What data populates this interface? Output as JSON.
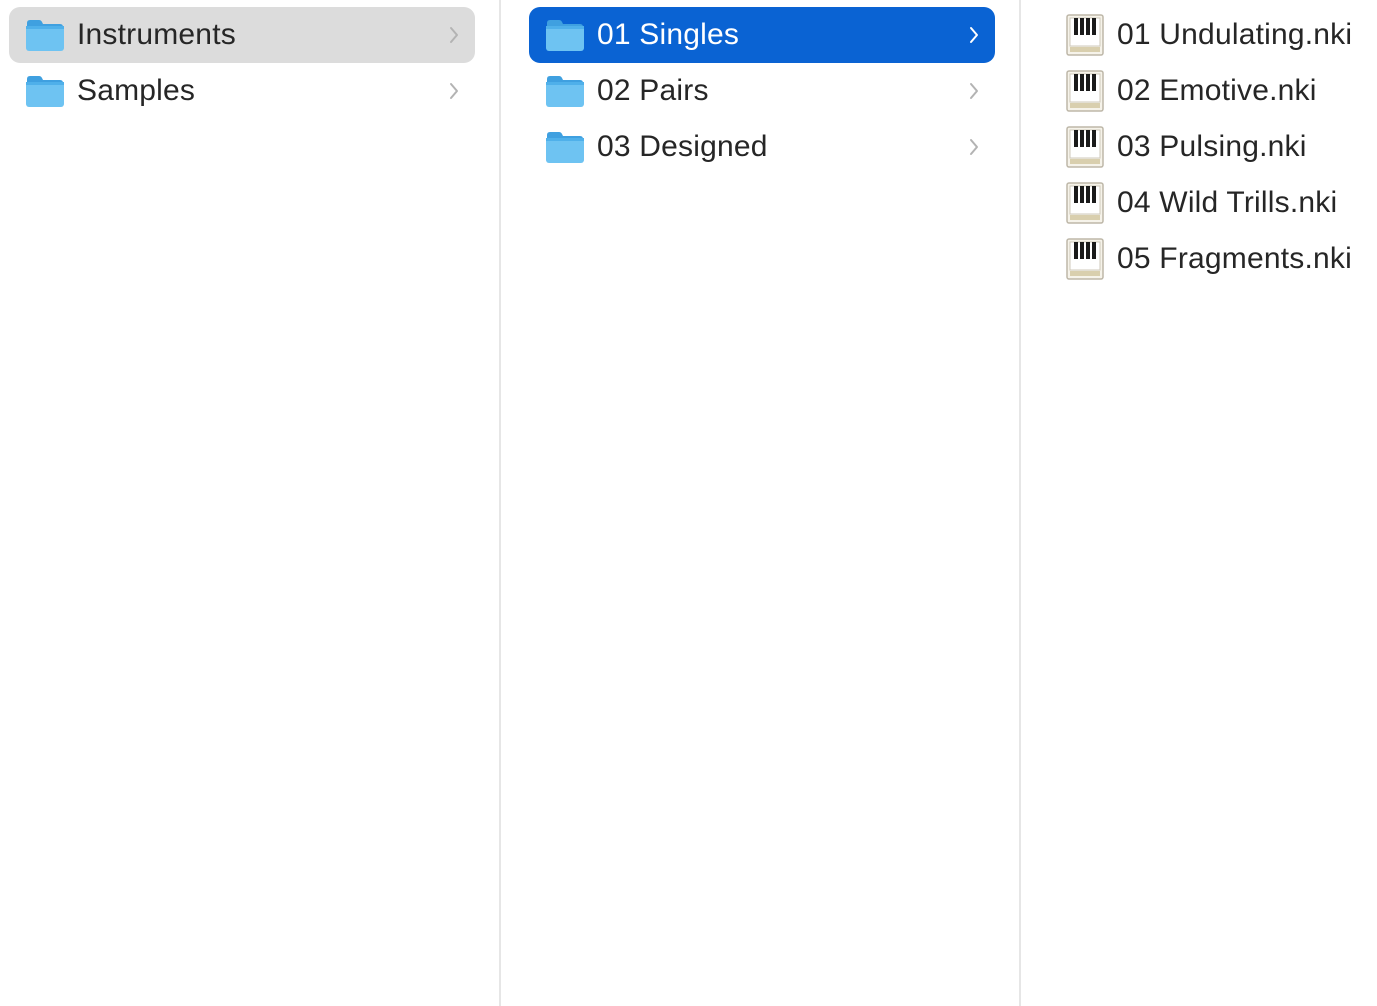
{
  "columns": [
    {
      "items": [
        {
          "label": "Instruments",
          "icon": "folder-icon",
          "state": "selected-inactive",
          "has_children": true
        },
        {
          "label": "Samples",
          "icon": "folder-icon",
          "state": "normal",
          "has_children": true
        }
      ]
    },
    {
      "items": [
        {
          "label": "01 Singles",
          "icon": "folder-icon",
          "state": "selected-active",
          "has_children": true
        },
        {
          "label": "02 Pairs",
          "icon": "folder-icon",
          "state": "normal",
          "has_children": true
        },
        {
          "label": "03 Designed",
          "icon": "folder-icon",
          "state": "normal",
          "has_children": true
        }
      ]
    },
    {
      "items": [
        {
          "label": "01 Undulating.nki",
          "icon": "kontakt-instrument-file-icon"
        },
        {
          "label": "02 Emotive.nki",
          "icon": "kontakt-instrument-file-icon"
        },
        {
          "label": "03 Pulsing.nki",
          "icon": "kontakt-instrument-file-icon"
        },
        {
          "label": "04 Wild Trills.nki",
          "icon": "kontakt-instrument-file-icon"
        },
        {
          "label": "05 Fragments.nki",
          "icon": "kontakt-instrument-file-icon"
        }
      ]
    }
  ],
  "colors": {
    "selection_active": "#0a63d3",
    "selection_inactive": "#dcdcdc",
    "folder_blue": "#5cb8ee",
    "text": "#262626"
  }
}
